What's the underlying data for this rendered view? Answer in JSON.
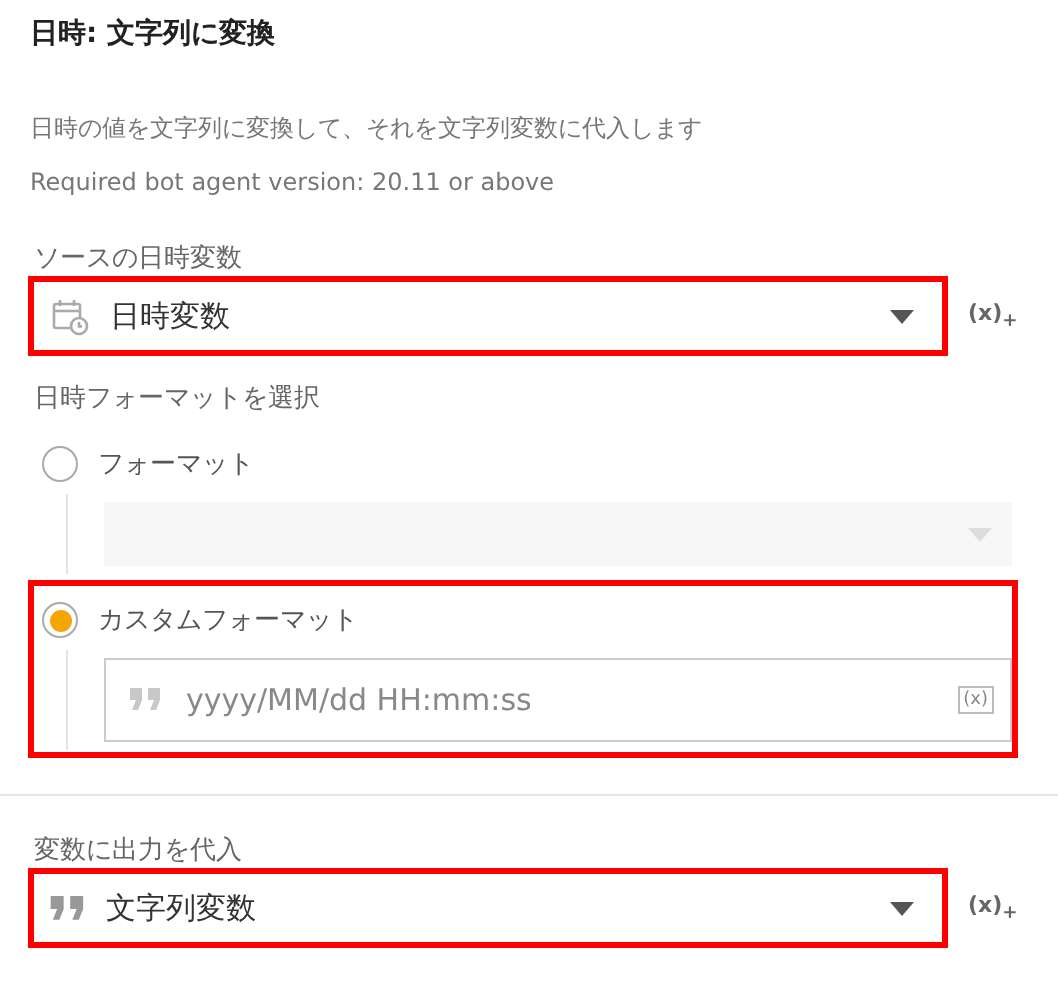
{
  "title": "日時: 文字列に変換",
  "description": "日時の値を文字列に変換して、それを文字列変数に代入します",
  "version_note": "Required bot agent version: 20.11 or above",
  "source": {
    "label": "ソースの日時変数",
    "value": "日時変数",
    "highlighted": true,
    "variable_button": "(x)$_{+}$"
  },
  "format": {
    "label": "日時フォーマットを選択",
    "options": [
      {
        "kind": "preset",
        "label": "フォーマット",
        "selected": false,
        "highlighted": false
      },
      {
        "kind": "custom",
        "label": "カスタムフォーマット",
        "selected": true,
        "highlighted": true,
        "value": "yyyy/MM/dd HH:mm:ss",
        "variable_icon": "(x)"
      }
    ]
  },
  "output": {
    "label": "変数に出力を代入",
    "value": "文字列変数",
    "highlighted": true,
    "variable_button": "(x)$_{+}$"
  }
}
